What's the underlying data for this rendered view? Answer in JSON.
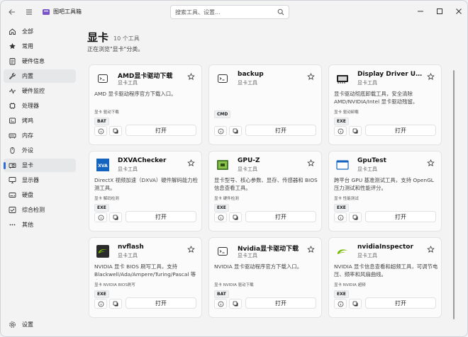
{
  "app": {
    "title": "图吧工具箱"
  },
  "search": {
    "placeholder": "搜索工具、设置..."
  },
  "sidebar": {
    "items": [
      {
        "label": "全部",
        "icon": "home-icon"
      },
      {
        "label": "常用",
        "icon": "star-icon"
      },
      {
        "label": "硬件信息",
        "icon": "clipboard-icon"
      },
      {
        "label": "内置",
        "icon": "wrench-icon"
      },
      {
        "label": "硬件监控",
        "icon": "pulse-icon"
      },
      {
        "label": "处理器",
        "icon": "cpu-icon"
      },
      {
        "label": "烤鸡",
        "icon": "flame-icon"
      },
      {
        "label": "内存",
        "icon": "memory-icon"
      },
      {
        "label": "外设",
        "icon": "mouse-icon"
      },
      {
        "label": "显卡",
        "icon": "gpu-icon"
      },
      {
        "label": "显示器",
        "icon": "monitor-icon"
      },
      {
        "label": "硬盘",
        "icon": "disk-icon"
      },
      {
        "label": "综合检测",
        "icon": "check-icon"
      },
      {
        "label": "其他",
        "icon": "more-icon"
      }
    ],
    "settings_label": "设置"
  },
  "header": {
    "title": "显卡",
    "count": "10 个工具",
    "subtitle": "正在浏览\"显卡\"分类。"
  },
  "open_label": "打开",
  "cards": [
    {
      "name": "AMD显卡驱动下载",
      "category": "显卡工具",
      "desc": "AMD 显卡驱动程序官方下载入口。",
      "tags": "显卡  驱动下载",
      "type": "BAT",
      "icon": "terminal-icon"
    },
    {
      "name": "backup",
      "category": "显卡工具",
      "desc": "",
      "tags": "",
      "type": "CMD",
      "icon": "terminal-icon"
    },
    {
      "name": "Display Driver Uninst...",
      "category": "显卡工具",
      "desc": "显卡驱动彻底卸载工具，安全清除 AMD/NVIDIA/Intel 显卡驱动残留。",
      "tags": "显卡  驱动卸载",
      "type": "EXE",
      "icon": "ddu-icon"
    },
    {
      "name": "DXVAChecker",
      "category": "显卡工具",
      "desc": "DirectX 视频加速（DXVA）硬件解码能力检测工具。",
      "tags": "显卡  解码检测",
      "type": "EXE",
      "icon": "dxva-icon"
    },
    {
      "name": "GPU-Z",
      "category": "显卡工具",
      "desc": "显卡型号、核心参数、显存、传感器和 BIOS 信息查看工具。",
      "tags": "显卡  硬件检测",
      "type": "EXE",
      "icon": "gpuz-icon"
    },
    {
      "name": "GpuTest",
      "category": "显卡工具",
      "desc": "跨平台 GPU 基准测试工具，支持 OpenGL 压力测试和性能评分。",
      "tags": "显卡  性能测试",
      "type": "EXE",
      "icon": "gputest-icon"
    },
    {
      "name": "nvflash",
      "category": "显卡工具",
      "desc": "NVIDIA 显卡 BIOS 刷写工具，支持 Blackwell/Ada/Ampere/Turing/Pascal 等全...",
      "tags": "显卡  NVIDIA  BIOS刷写",
      "type": "EXE",
      "icon": "nvidia-icon"
    },
    {
      "name": "Nvidia显卡驱动下载",
      "category": "显卡工具",
      "desc": "NVIDIA 显卡驱动程序官方下载入口。",
      "tags": "显卡  NVIDIA  驱动下载",
      "type": "BAT",
      "icon": "terminal-icon"
    },
    {
      "name": "nvidiaInspector",
      "category": "显卡工具",
      "desc": "NVIDIA 显卡信息查看和超频工具，可调节电压、频率和风扇曲线。",
      "tags": "显卡  NVIDIA  超频",
      "type": "EXE",
      "icon": "nvidia-icon"
    }
  ],
  "colors": {
    "accent": "#2f6bd9",
    "nvidia": "#76b900"
  }
}
